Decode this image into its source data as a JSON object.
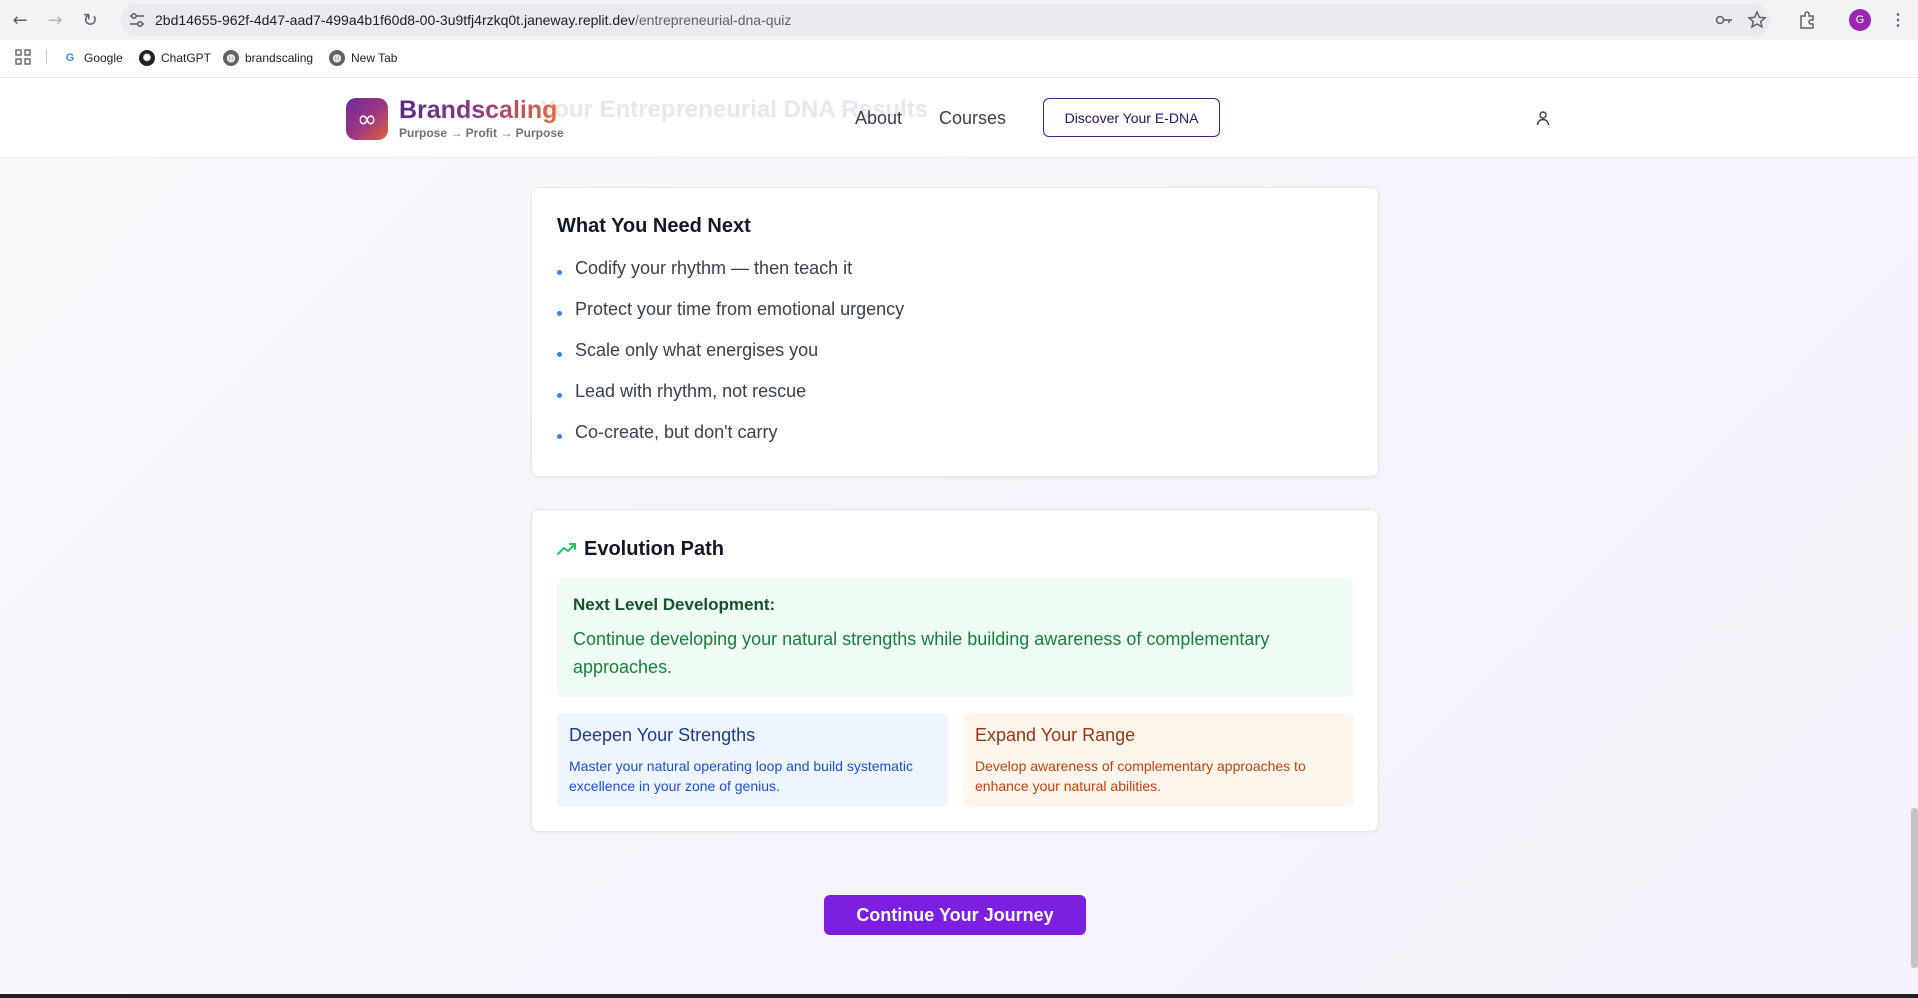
{
  "browser": {
    "url_host": "2bd14655-962f-4d47-aad7-499a4b1f60d8-00-3u9tfj4rzkq0t.janeway.replit.dev",
    "url_path": "/entrepreneurial-dna-quiz",
    "profile_initial": "G",
    "bookmarks": [
      {
        "label": "Google",
        "icon": "google-icon",
        "color": "#4285f4"
      },
      {
        "label": "ChatGPT",
        "icon": "chatgpt-icon",
        "color": "#202124"
      },
      {
        "label": "brandscaling",
        "icon": "globe-icon",
        "color": "#5f6368"
      },
      {
        "label": "New Tab",
        "icon": "globe-icon",
        "color": "#5f6368"
      }
    ]
  },
  "header": {
    "brand_name": "Brandscaling",
    "brand_tagline": "Purpose → Profit → Purpose",
    "nav": [
      "About",
      "Courses"
    ],
    "cta": "Discover Your E-DNA",
    "ghost_title": "Your Entrepreneurial DNA Results",
    "logo_symbol": "∞"
  },
  "needs_card": {
    "title": "What You Need Next",
    "items": [
      "Codify your rhythm — then teach it",
      "Protect your time from emotional urgency",
      "Scale only what energises you",
      "Lead with rhythm, not rescue",
      "Co-create, but don't carry"
    ]
  },
  "evolution_card": {
    "title": "Evolution Path",
    "next_level_heading": "Next Level Development:",
    "next_level_body": "Continue developing your natural strengths while building awareness of complementary approaches.",
    "deepen": {
      "title": "Deepen Your Strengths",
      "body": "Master your natural operating loop and build systematic excellence in your zone of genius."
    },
    "expand": {
      "title": "Expand Your Range",
      "body": "Develop awareness of complementary approaches to enhance your natural abilities."
    }
  },
  "continue_button": "Continue Your Journey",
  "colors": {
    "accent_purple": "#7c1fe0",
    "bullet_blue": "#3b82f6",
    "green_text": "#15803d",
    "orange_text": "#c2410c"
  }
}
